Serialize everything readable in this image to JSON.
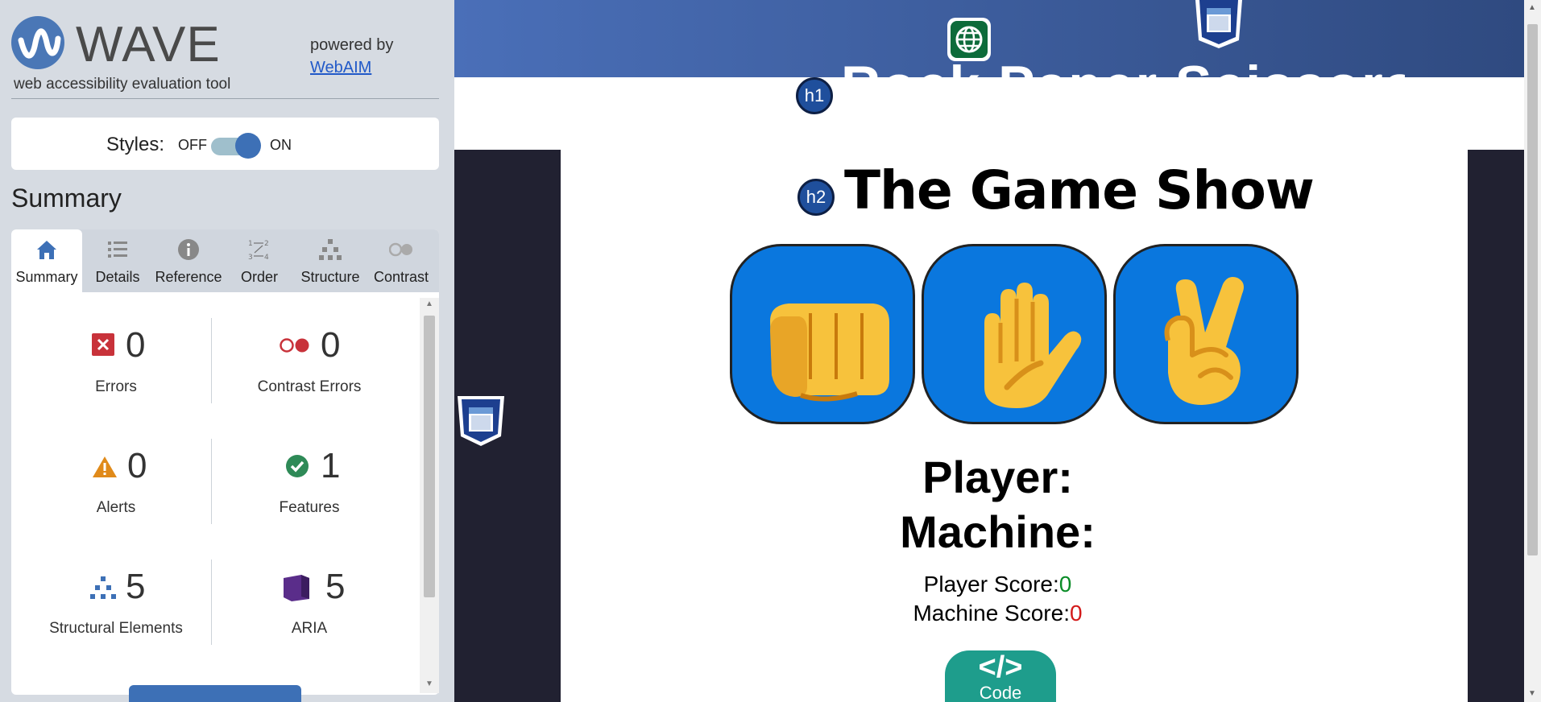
{
  "wave": {
    "logo": "WAVE",
    "tagline": "web accessibility evaluation tool",
    "powered_by": "powered by",
    "powered_link": "WebAIM",
    "styles": {
      "label": "Styles:",
      "off": "OFF",
      "on": "ON",
      "state": "on"
    },
    "summary_heading": "Summary",
    "tabs": [
      {
        "label": "Summary",
        "icon": "home-icon",
        "active": true
      },
      {
        "label": "Details",
        "icon": "list-icon",
        "active": false
      },
      {
        "label": "Reference",
        "icon": "info-icon",
        "active": false
      },
      {
        "label": "Order",
        "icon": "order-icon",
        "active": false
      },
      {
        "label": "Structure",
        "icon": "structure-icon",
        "active": false
      },
      {
        "label": "Contrast",
        "icon": "contrast-icon",
        "active": false
      }
    ],
    "stats": {
      "errors": {
        "count": "0",
        "label": "Errors"
      },
      "contrast_errors": {
        "count": "0",
        "label": "Contrast Errors"
      },
      "alerts": {
        "count": "0",
        "label": "Alerts"
      },
      "features": {
        "count": "1",
        "label": "Features"
      },
      "structural": {
        "count": "5",
        "label": "Structural Elements"
      },
      "aria": {
        "count": "5",
        "label": "ARIA"
      }
    },
    "colors": {
      "accent": "#3d70b6",
      "error": "#c8323a",
      "alert": "#e08a1a",
      "feature": "#2e8a57",
      "aria": "#5a2d8a"
    }
  },
  "page": {
    "h1_badge": "h1",
    "h2_badge": "h2",
    "site_title": "Rock Paper Scissors?",
    "game_title": "The Game Show",
    "choices": [
      "rock",
      "paper",
      "scissors"
    ],
    "player_label": "Player:",
    "machine_label": "Machine:",
    "player_score_label": "Player Score:",
    "player_score": "0",
    "machine_score_label": "Machine Score:",
    "machine_score": "0",
    "code_badge": "Code",
    "code_symbol": "</>"
  }
}
